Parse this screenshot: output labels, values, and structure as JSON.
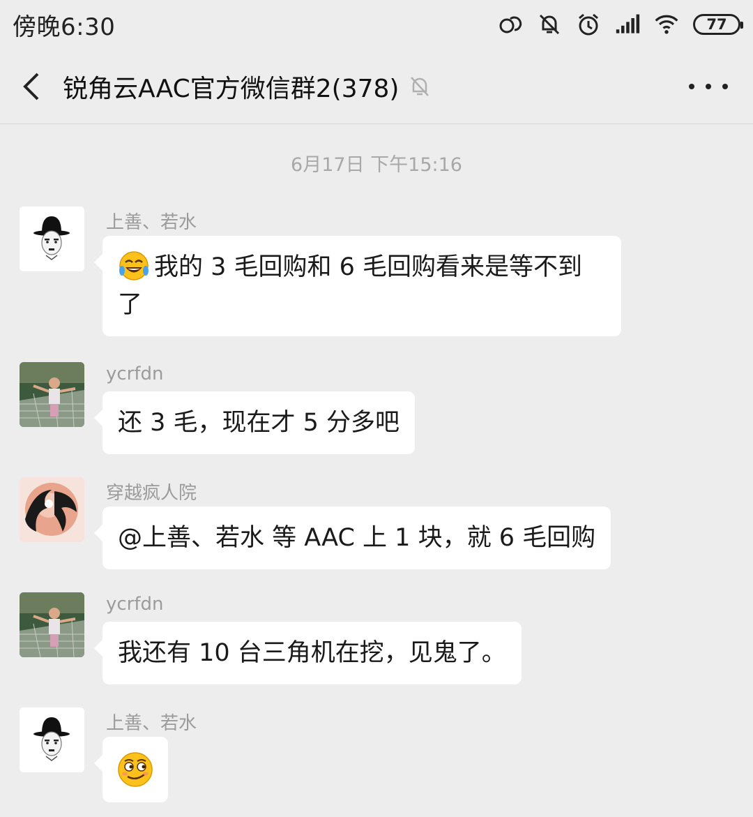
{
  "status_bar": {
    "time": "傍晚6:30",
    "battery": "77",
    "icons": [
      "link-icon",
      "bell-muted-icon",
      "alarm-icon",
      "signal-icon",
      "wifi-icon",
      "battery-icon"
    ]
  },
  "nav": {
    "title": "锐角云AAC官方微信群2(378)",
    "back_icon": "chevron-left-icon",
    "mute_icon": "bell-muted-icon",
    "more_icon": "more-icon"
  },
  "chat": {
    "timestamp": "6月17日 下午15:16",
    "messages": [
      {
        "sender": "上善、若水",
        "text": "我的 3 毛回购和 6 毛回购看来是等不到了",
        "emoji": "tears-of-joy"
      },
      {
        "sender": "ycrfdn",
        "text": "还 3 毛，现在才 5 分多吧"
      },
      {
        "sender": "穿越疯人院",
        "text": "@上善、若水 等 AAC 上 1 块，就 6 毛回购"
      },
      {
        "sender": "ycrfdn",
        "text": "我还有 10 台三角机在挖，见鬼了。"
      },
      {
        "sender": "上善、若水",
        "text": "",
        "emoji": "smirk-face"
      }
    ]
  },
  "colors": {
    "background": "#ededed",
    "bubble": "#ffffff",
    "meta_text": "#9b9b9b"
  }
}
